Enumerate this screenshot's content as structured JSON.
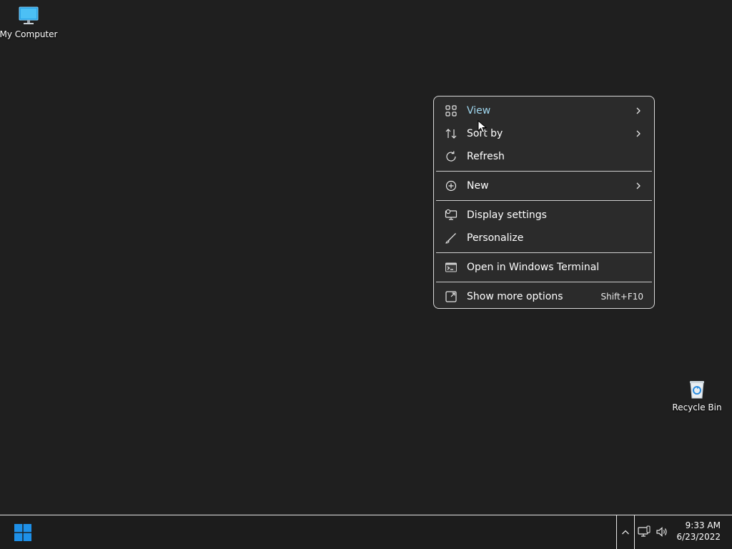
{
  "desktop": {
    "icons": [
      {
        "label": "My Computer",
        "icon": "monitor-icon"
      },
      {
        "label": "Recycle Bin",
        "icon": "recycle-bin-icon"
      }
    ]
  },
  "context_menu": {
    "items": [
      {
        "label": "View",
        "icon": "grid-icon",
        "submenu": true
      },
      {
        "label": "Sort by",
        "icon": "sort-icon",
        "submenu": true
      },
      {
        "label": "Refresh",
        "icon": "refresh-icon"
      },
      {
        "label": "New",
        "icon": "plus-circle-icon",
        "submenu": true
      },
      {
        "label": "Display settings",
        "icon": "display-settings-icon"
      },
      {
        "label": "Personalize",
        "icon": "brush-icon"
      },
      {
        "label": "Open in Windows Terminal",
        "icon": "terminal-icon"
      },
      {
        "label": "Show more options",
        "icon": "expand-icon",
        "shortcut": "Shift+F10"
      }
    ]
  },
  "taskbar": {
    "start_icon": "windows-logo-icon",
    "tray": {
      "chevron_icon": "chevron-up-icon",
      "network_icon": "network-icon",
      "volume_icon": "volume-icon"
    },
    "clock": {
      "time": "9:33 AM",
      "date": "6/23/2022"
    }
  },
  "colors": {
    "desktop_bg": "#1f1f1f",
    "menu_bg": "#2b2b2b",
    "hover_text": "#9fd6ee",
    "windows_blue": "#1e90e8"
  }
}
